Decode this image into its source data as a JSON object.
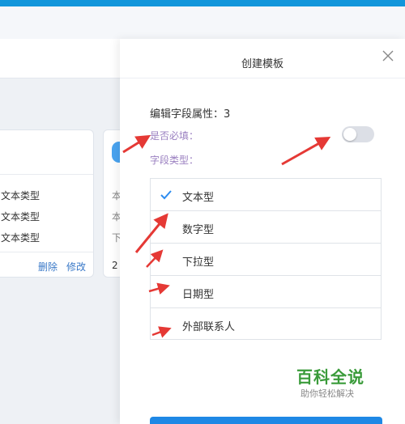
{
  "background": {
    "card1": {
      "rows": [
        "文本类型",
        "文本类型",
        "文本类型"
      ],
      "delete_label": "删除",
      "edit_label": "修改"
    },
    "card2": {
      "rows": [
        "本",
        "本",
        "下"
      ],
      "footer": "2"
    }
  },
  "modal": {
    "title": "创建模板",
    "field_attr": "编辑字段属性：3",
    "required_label": "是否必填：",
    "required_on": false,
    "type_label": "字段类型：",
    "types": [
      {
        "label": "文本型",
        "selected": true
      },
      {
        "label": "数字型",
        "selected": false
      },
      {
        "label": "下拉型",
        "selected": false
      },
      {
        "label": "日期型",
        "selected": false
      },
      {
        "label": "外部联系人",
        "selected": false
      }
    ]
  },
  "watermark": {
    "brand": "百科全说",
    "slogan": "助你轻松解决"
  },
  "colors": {
    "accent": "#1296db",
    "annotation": "#e53935",
    "label": "#9a7fc0",
    "watermark": "#3a9b3a"
  },
  "icons": {
    "close": "close-icon",
    "check": "check-icon"
  }
}
